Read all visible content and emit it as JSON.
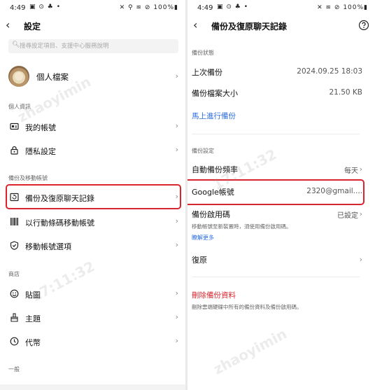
{
  "left": {
    "status": {
      "time": "4:49",
      "left_icons": "▣ ⊙ ♣ •",
      "right_icons": "✕ ⚲ ≋ ⊘ 100%▮"
    },
    "title": "設定",
    "search": {
      "placeholder": "搜尋設定項目、支援中心服務說明"
    },
    "profile": {
      "label": "個人檔案"
    },
    "sections": {
      "personal": "個人資訊",
      "backup": "備份及移動帳號",
      "store": "商店",
      "general": "一般"
    },
    "items": {
      "my_account": "我的帳號",
      "privacy": "隱私設定",
      "backup_restore": "備份及復原聊天記錄",
      "barcode_move": "以行動條碼移動帳號",
      "account_move_option": "移動帳號選項",
      "stickers": "貼圖",
      "themes": "主題",
      "coins": "代幣"
    }
  },
  "right": {
    "status": {
      "time": "4:49",
      "left_icons": "▣ ⊙ ♣ •",
      "right_icons": "✕ ≋ ⊘ 100%▮"
    },
    "title": "備份及復原聊天記錄",
    "section_backup_status": "備份狀態",
    "last_backup": {
      "label": "上次備份",
      "value": "2024.09.25 18:03"
    },
    "backup_size": {
      "label": "備份檔案大小",
      "value": "21.50 KB"
    },
    "backup_now": "馬上進行備份",
    "section_backup_settings": "備份設定",
    "auto_backup": {
      "label": "自動備份頻率",
      "value": "每天"
    },
    "google_account": {
      "label": "Google帳號",
      "value": "2320@gmail...."
    },
    "backup_pin": {
      "label": "備份啟用碼",
      "value": "已設定",
      "note": "移動帳號至新裝置時，須使用備份啟用碼。",
      "link": "瞭解更多"
    },
    "restore": "復原",
    "delete_backup": {
      "label": "刪除備份資料",
      "note": "刪除雲端硬碟中所有的備份資料及備份啟用碼。"
    }
  },
  "watermark": {
    "text1": "zhaoyimin",
    "text2": "17:11:32"
  },
  "colors": {
    "highlight": "#d9262e",
    "link_blue": "#2b6de0",
    "delete_red": "#d9262e"
  }
}
